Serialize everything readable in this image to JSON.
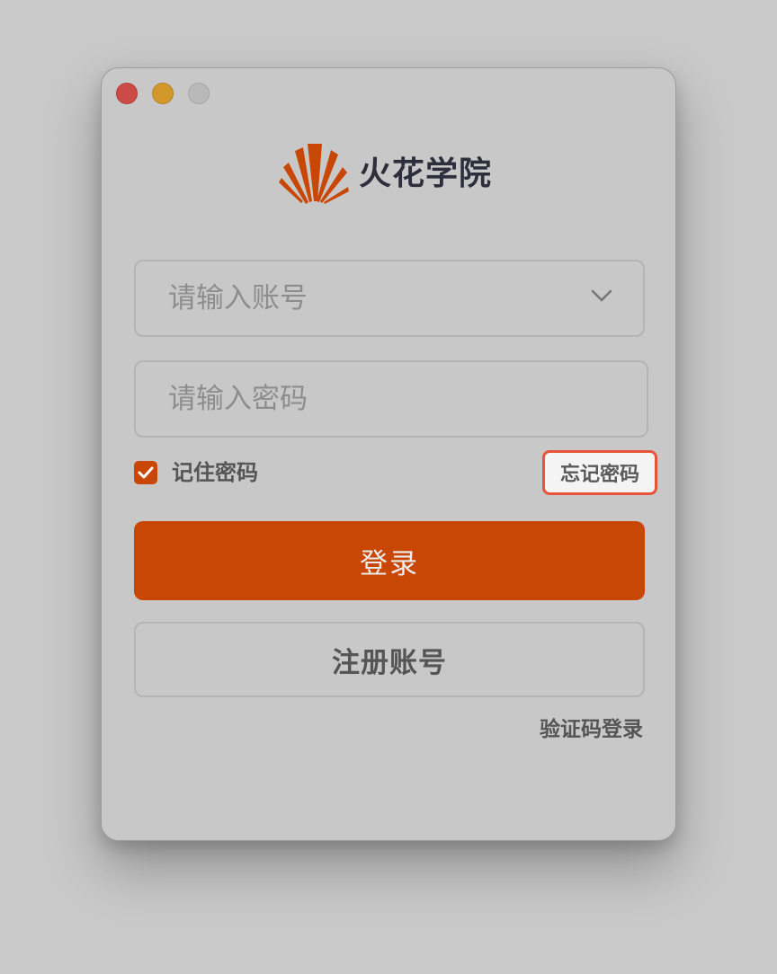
{
  "window": {
    "controls": [
      "close-icon",
      "minimize-icon",
      "maximize-icon"
    ]
  },
  "brand": {
    "name": "火花学院",
    "logo_icon": "spark-fan-logo",
    "accent_color": "#c84705"
  },
  "account": {
    "placeholder": "请输入账号",
    "value": "",
    "dropdown_icon": "chevron-down-icon"
  },
  "password": {
    "placeholder": "请输入密码",
    "value": ""
  },
  "remember": {
    "label": "记住密码",
    "checked": true
  },
  "forgot": {
    "label": "忘记密码",
    "highlight_color": "#e8543a"
  },
  "login": {
    "label": "登录"
  },
  "register": {
    "label": "注册账号"
  },
  "sms_login": {
    "label": "验证码登录"
  }
}
